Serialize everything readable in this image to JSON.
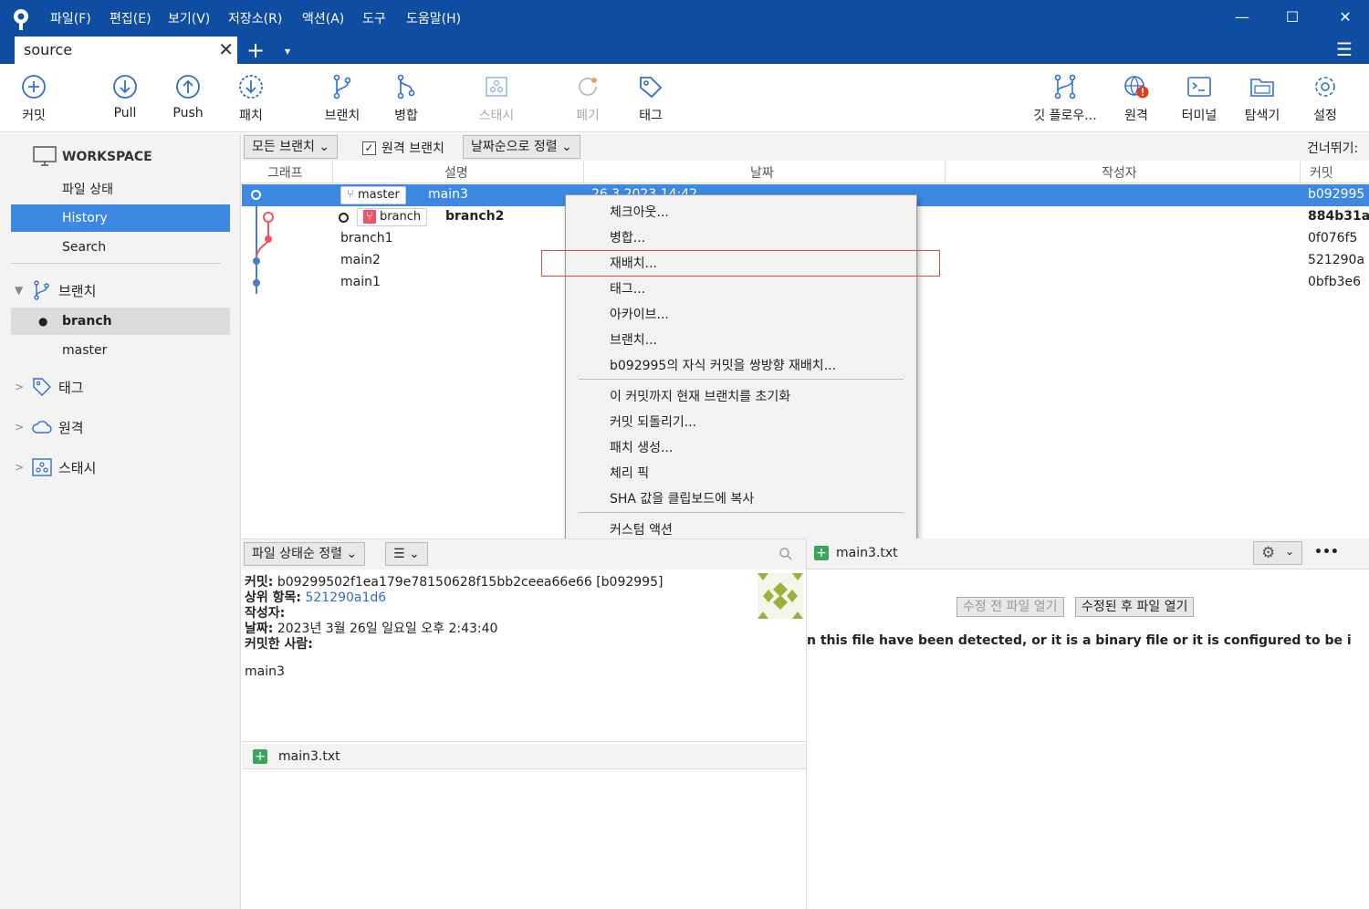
{
  "menu": [
    "파일(F)",
    "편집(E)",
    "보기(V)",
    "저장소(R)",
    "액션(A)",
    "도구",
    "도움말(H)"
  ],
  "window_controls": {
    "minimize": "—",
    "maximize": "☐",
    "close": "✕"
  },
  "tab": {
    "label": "source",
    "close": "✕",
    "add": "+",
    "dropdown": "▾"
  },
  "hamburger": "☰",
  "toolbar": {
    "commit": "커밋",
    "pull": "Pull",
    "push": "Push",
    "fetch": "패치",
    "branch": "브랜치",
    "merge": "병합",
    "stash": "스태시",
    "discard": "폐기",
    "tag": "태그",
    "git_flow": "깃 플로우...",
    "remote": "원격",
    "terminal": "터미널",
    "explorer": "탐색기",
    "settings": "설정"
  },
  "sidebar": {
    "workspace": "WORKSPACE",
    "workspace_items": [
      "파일 상태",
      "History",
      "Search"
    ],
    "branches_label": "브랜치",
    "branches": [
      "branch",
      "master"
    ],
    "tags_label": "태그",
    "remotes_label": "원격",
    "stashes_label": "스태시"
  },
  "filter": {
    "branches": "모든 브랜치",
    "remote_checkbox": "원격 브랜치",
    "sort": "날짜순으로 정렬",
    "jump": "건너뛰기:"
  },
  "columns": [
    "그래프",
    "설명",
    "날짜",
    "작성자",
    "커밋"
  ],
  "commits": [
    {
      "badge": "master",
      "desc": "main3",
      "date": "26 3 2023 14:42",
      "hash": "b092995"
    },
    {
      "badge": "branch",
      "desc": "branch2",
      "date": "",
      "hash": "884b31a"
    },
    {
      "badge": "",
      "desc": "branch1",
      "date": "",
      "hash": "0f076f5"
    },
    {
      "badge": "",
      "desc": "main2",
      "date": "",
      "hash": "521290a"
    },
    {
      "badge": "",
      "desc": "main1",
      "date": "",
      "hash": "0bfb3e6"
    }
  ],
  "context_menu": [
    "체크아웃...",
    "병합...",
    "재배치...",
    "태그...",
    "아카이브...",
    "브랜치...",
    "b092995의 자식 커밋을 쌍방향 재배치...",
    "이 커밋까지 현재 브랜치를 초기화",
    "커밋 되돌리기...",
    "패치 생성...",
    "체리 픽",
    "SHA 값을 클립보드에 복사",
    "커스텀 액션"
  ],
  "lower": {
    "sort": "파일 상태순 정렬",
    "list_mode": "☰"
  },
  "detail": {
    "commit_label": "커밋:",
    "commit_value": "b09299502f1ea179e78150628f15bb2ceea66e66 [b092995]",
    "parent_label": "상위 항목:",
    "parent_value": "521290a1d6",
    "author_label": "작성자:",
    "date_label": "날짜:",
    "date_value": "2023년 3월 26일 일요일 오후 2:43:40",
    "committer_label": "커밋한 사람:",
    "message": "main3"
  },
  "file_list": [
    "main3.txt"
  ],
  "right_pane": {
    "file": "main3.txt",
    "btn_before": "수정 전 파일 열기",
    "btn_after": "수정된 후 파일 열기",
    "message": "n this file have been detected, or it is a binary file or it is configured to be ignored by the",
    "more": "•••"
  },
  "colors": {
    "accent": "#0f4da2",
    "selection": "#3c88e3",
    "branch_badge": "#e8546a",
    "highlight": "#e24b4b"
  }
}
